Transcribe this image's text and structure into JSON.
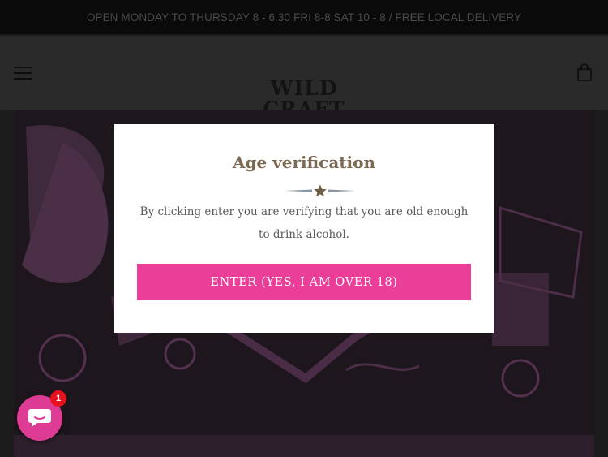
{
  "announcement": {
    "text": "OPEN MONDAY TO THURSDAY 8 - 6.30 FRI 8-8 SAT 10 - 8 / FREE LOCAL DELIVERY"
  },
  "header": {
    "menu_icon": "hamburger-menu-icon",
    "cart_icon": "shopping-bag-icon",
    "logo": {
      "line1": "WILD",
      "line2": "CRAFT"
    }
  },
  "modal": {
    "title": "Age verification",
    "divider_icon": "star-divider-icon",
    "message": "By clicking enter you are verifying that you are old enough to drink alcohol.",
    "button_label": "ENTER (YES, I AM OVER 18)"
  },
  "chat": {
    "icon": "chat-bubble-icon",
    "badge_count": "1"
  },
  "colors": {
    "accent": "#ea3e99",
    "title": "#7d6a52",
    "overlay": "#000000",
    "badge": "#e8101d"
  }
}
